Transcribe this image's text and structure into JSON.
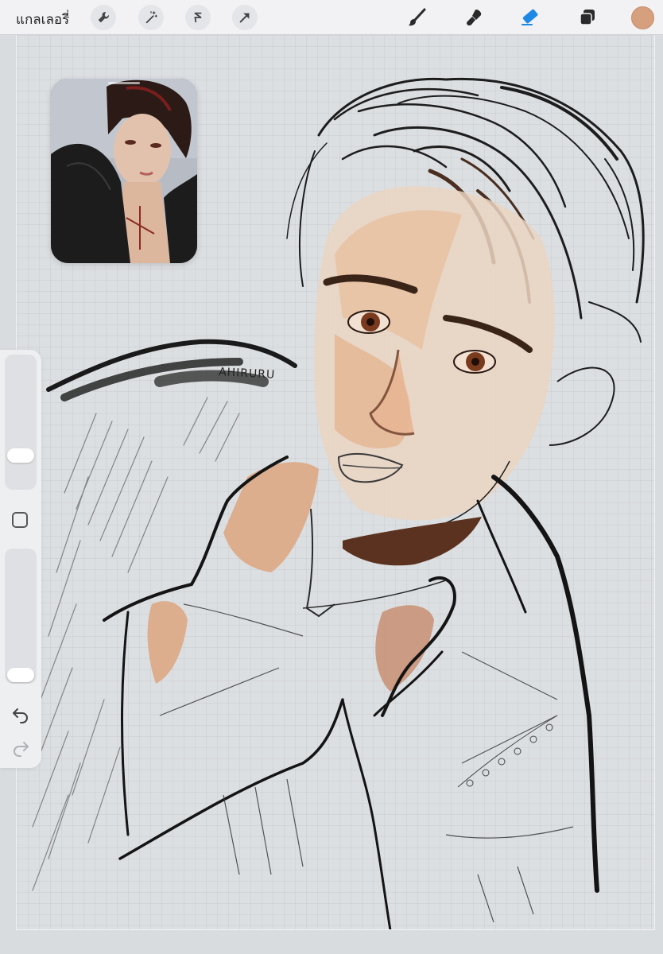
{
  "topbar": {
    "gallery_label": "แกลเลอรี่",
    "left_tools": [
      "wrench-icon",
      "magic-wand-icon",
      "selection-icon",
      "transform-arrow-icon"
    ],
    "right_tools": [
      "brush-icon",
      "smudge-icon",
      "eraser-icon",
      "layers-icon"
    ],
    "active_tool": "eraser-icon",
    "current_color": "#d69f7e",
    "accent_color": "#1e88e5"
  },
  "canvas": {
    "signature": "AHIRURU"
  },
  "sidebar": {
    "brush_size_level": 0.15,
    "opacity_level": 0.02,
    "modify_icon": "square-icon",
    "undo_icon": "undo-icon",
    "redo_icon": "redo-icon"
  },
  "reference": {
    "icon": "reference-photo"
  }
}
